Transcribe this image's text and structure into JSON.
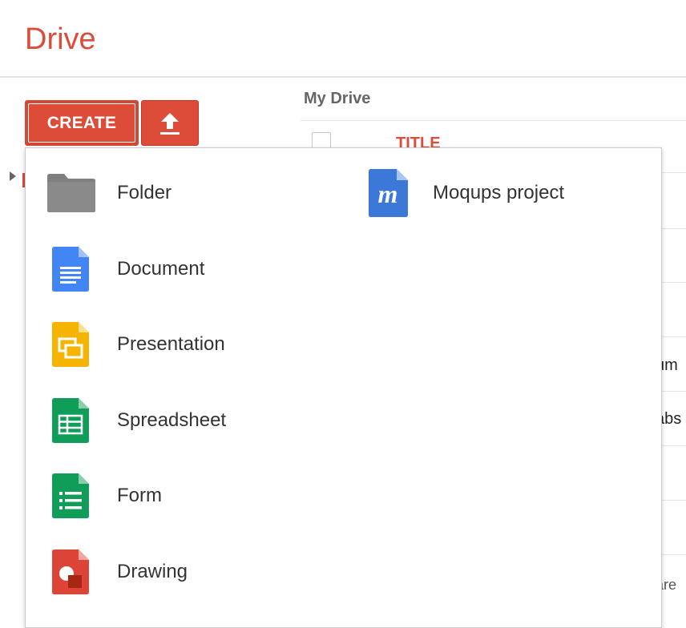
{
  "app": {
    "title": "Drive"
  },
  "toolbar": {
    "create_label": "CREATE",
    "upload_icon": "upload-arrow-icon"
  },
  "main": {
    "section_title": "My Drive",
    "columns": {
      "title": "TITLE"
    },
    "peek_texts": [
      "um",
      "abs",
      "are"
    ]
  },
  "create_menu": {
    "items": [
      {
        "label": "Folder",
        "icon": "folder-icon",
        "color": "#7a7a7a"
      },
      {
        "label": "Moqups project",
        "icon": "moqups-icon",
        "color": "#3a77d6"
      },
      {
        "label": "Document",
        "icon": "document-icon",
        "color": "#4285f4"
      },
      {
        "label": "Presentation",
        "icon": "presentation-icon",
        "color": "#f4b400"
      },
      {
        "label": "Spreadsheet",
        "icon": "spreadsheet-icon",
        "color": "#0f9d58"
      },
      {
        "label": "Form",
        "icon": "form-icon",
        "color": "#0f9d58"
      },
      {
        "label": "Drawing",
        "icon": "drawing-icon",
        "color": "#db4437"
      }
    ]
  },
  "colors": {
    "brand": "#dd4b39",
    "accent": "#d14836"
  }
}
